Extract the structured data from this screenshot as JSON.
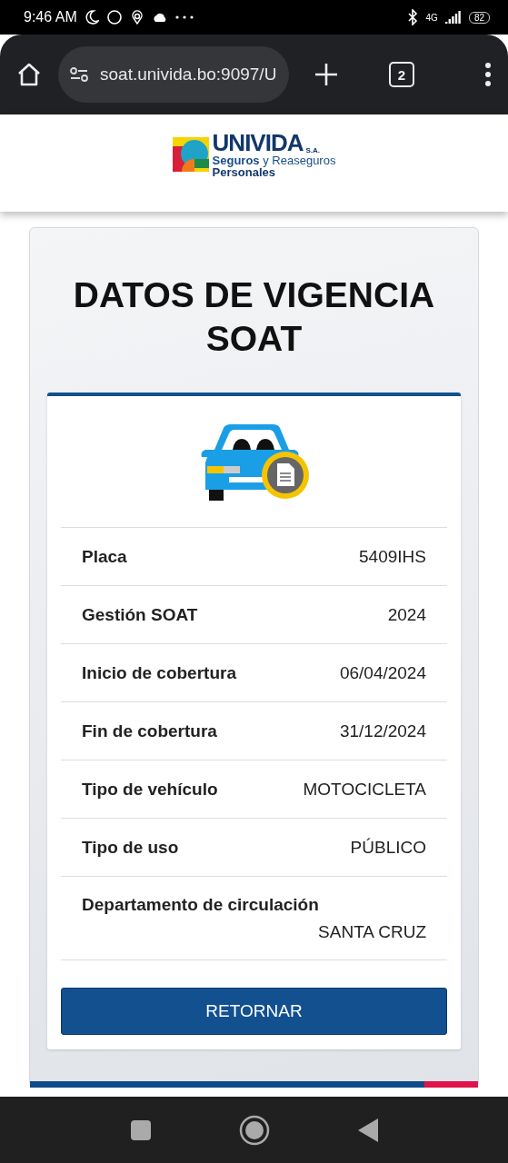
{
  "status_bar": {
    "time": "9:46 AM",
    "network": "4G",
    "battery": "82"
  },
  "browser": {
    "url": "soat.univida.bo:9097/U",
    "tab_count": "2"
  },
  "logo": {
    "name": "UNIVIDA",
    "suffix": "S.A.",
    "tagline": "**Seguros** y Reaseguros",
    "tagline_2": "Personales"
  },
  "title": "DATOS DE VIGENCIA SOAT",
  "details": [
    {
      "label": "Placa",
      "value": "5409IHS",
      "kind": "inline"
    },
    {
      "label": "Gestión SOAT",
      "value": "2024",
      "kind": "inline"
    },
    {
      "label": "Inicio de cobertura",
      "value": "06/04/2024",
      "kind": "inline"
    },
    {
      "label": "Fin de cobertura",
      "value": "31/12/2024",
      "kind": "inline"
    },
    {
      "label": "Tipo de vehículo",
      "value": "MOTOCICLETA",
      "kind": "inline"
    },
    {
      "label": "Tipo de uso",
      "value": "PÚBLICO",
      "kind": "inline"
    },
    {
      "label": "Departamento de circulación",
      "value": "SANTA CRUZ",
      "kind": "stacked"
    }
  ],
  "button": "RETORNAR"
}
